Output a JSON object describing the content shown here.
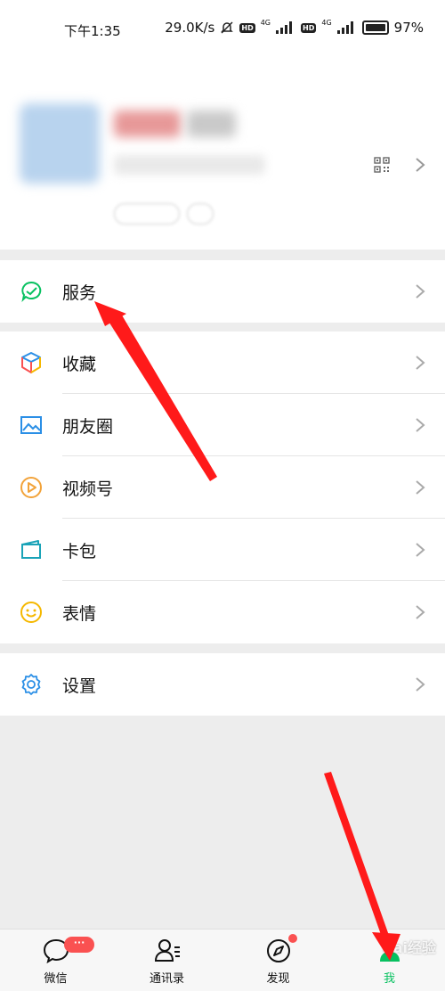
{
  "status_bar": {
    "time": "下午1:35",
    "speed": "29.0K/s",
    "hd1": "HD",
    "hd2": "HD",
    "net1": "4G",
    "net2": "4G",
    "battery": "97%"
  },
  "menu": {
    "service": "服务",
    "favorites": "收藏",
    "moments": "朋友圈",
    "channels": "视频号",
    "cards": "卡包",
    "stickers": "表情",
    "settings": "设置"
  },
  "tabbar": {
    "wechat": "微信",
    "wechat_badge": "···",
    "contacts": "通讯录",
    "discover": "发现",
    "me": "我",
    "active": "me"
  },
  "watermark": "Bai经验",
  "colors": {
    "accent": "#07c160",
    "badge": "#fa5151",
    "annotation_arrow": "#ff1a1a"
  }
}
